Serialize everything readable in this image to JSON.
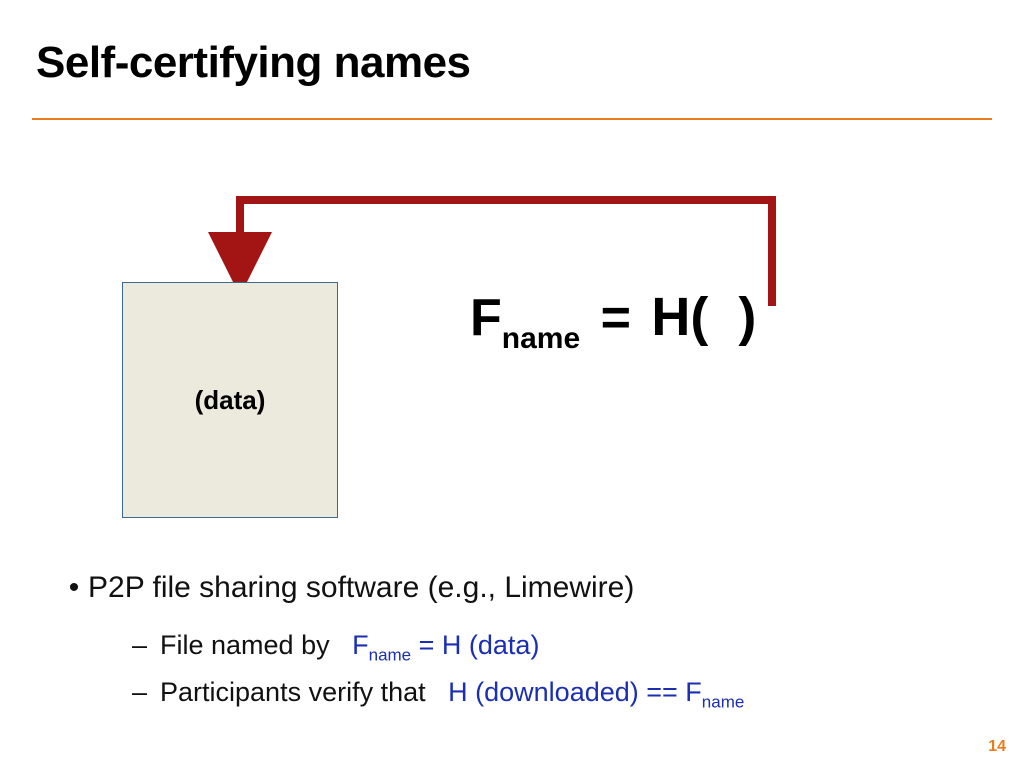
{
  "title": "Self-certifying names",
  "page_number": "14",
  "colors": {
    "rule": "#e97c1b",
    "arrow": "#a31515",
    "box_fill": "#eceadd",
    "box_border": "#3b6a8f",
    "link_blue": "#1a2fb3"
  },
  "databox": {
    "label": "(data)"
  },
  "formula": {
    "base": "F",
    "sub": "name",
    "eq": " = ",
    "hash_prefix": "H(",
    "hash_suffix": ")"
  },
  "bullets": {
    "main": "P2P file sharing software (e.g., Limewire)",
    "sub1": {
      "lead": "File named by",
      "formula_pre": "F",
      "formula_sub": "name",
      "formula_post": " = H (data)"
    },
    "sub2": {
      "lead": "Participants verify that",
      "formula_pre": "H (downloaded) == F",
      "formula_sub": "name"
    }
  }
}
